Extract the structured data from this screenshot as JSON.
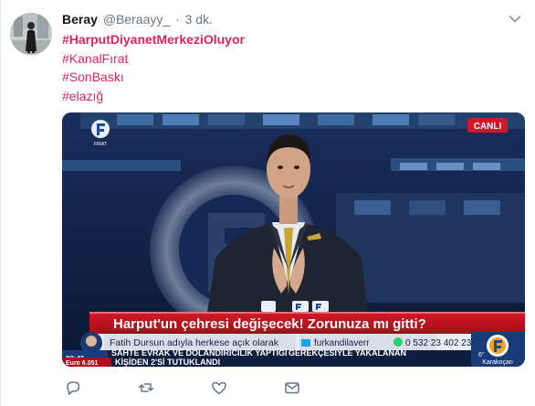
{
  "tweet": {
    "author_name": "Beray",
    "author_handle": "@Beraayy_",
    "separator": "·",
    "time": "3 dk.",
    "hashtags": [
      "#HarputDiyanetMerkeziOluyor",
      "#KanalFırat",
      "#SonBaskı",
      "#elazığ"
    ]
  },
  "media": {
    "channel_logo_text": "FIRAT",
    "live_badge": "CANLI",
    "headline": "Harput'un çehresi değişecek! Zorunuza mı gitti?",
    "twitter_handle": "furkandilaverr",
    "phone": "0 532 23 402 23",
    "ticker_top_left": "SAHTE EVRAK VE DOLANDIRICILIK YAPTIĞI",
    "ticker_top_right": "GEREKÇESİYLE YAKALANAN",
    "ticker_bottom": "KİŞİDEN 2'Sİ TUTUKLANDI",
    "caller_text": "Fatih Dursun adıyla herkese açık olarak",
    "euro_label": "Euro 6.051",
    "time_label": "20:46",
    "weather_temp": "6°",
    "weather_city": "Karakoçan"
  },
  "actions": [
    "reply-icon",
    "retweet-icon",
    "like-icon",
    "direct-message-icon"
  ],
  "colors": {
    "hashtag": "#e0245e",
    "muted": "#657786",
    "live_red": "#d3162a",
    "headline_red": "#c4121f",
    "ticker_red": "#b10d1a",
    "navy": "#0f1d3f"
  }
}
